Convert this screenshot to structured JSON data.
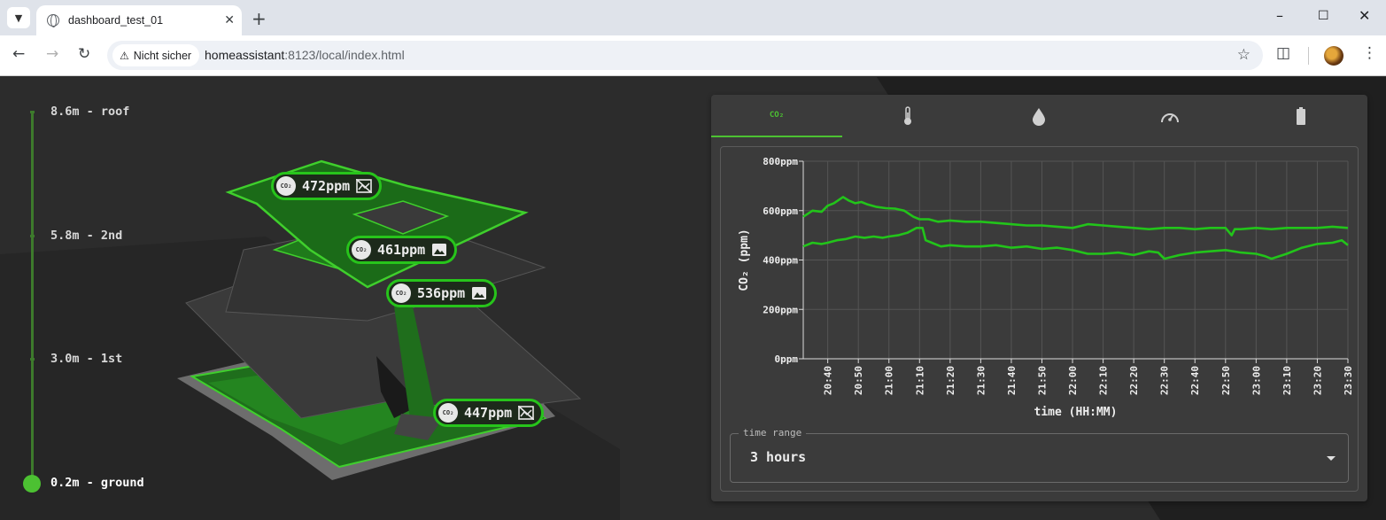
{
  "browser": {
    "tab_title": "dashboard_test_01",
    "security_label": "Nicht sicher",
    "url_host": "homeassistant",
    "url_rest": ":8123/local/index.html"
  },
  "levels": [
    {
      "label": "8.6m - roof"
    },
    {
      "label": "5.8m - 2nd"
    },
    {
      "label": "3.0m - 1st"
    },
    {
      "label": "0.2m - ground",
      "active": true
    }
  ],
  "sensors": [
    {
      "value": "472ppm",
      "icon": "image-off-icon"
    },
    {
      "value": "461ppm",
      "icon": "image-icon"
    },
    {
      "value": "536ppm",
      "icon": "image-icon"
    },
    {
      "value": "447ppm",
      "icon": "image-off-icon"
    }
  ],
  "co2_badge": "CO₂",
  "panel": {
    "tabs": [
      {
        "name": "co2",
        "label": "CO₂",
        "active": true
      },
      {
        "name": "temperature",
        "icon": "thermometer-icon"
      },
      {
        "name": "humidity",
        "icon": "water-drop-icon"
      },
      {
        "name": "pressure",
        "icon": "gauge-icon"
      },
      {
        "name": "battery",
        "icon": "battery-icon"
      }
    ],
    "time_range_label": "time range",
    "time_range_value": "3 hours"
  },
  "colors": {
    "accent": "#4cc132",
    "line": "#22c41a",
    "panel": "#3b3b3b"
  },
  "chart_data": {
    "type": "line",
    "xlabel": "time (HH:MM)",
    "ylabel": "CO₂ (ppm)",
    "ylim": [
      0,
      800
    ],
    "yticks": [
      "0ppm",
      "200ppm",
      "400ppm",
      "600ppm",
      "800ppm"
    ],
    "xticks": [
      "20:40",
      "20:50",
      "21:00",
      "21:10",
      "21:20",
      "21:30",
      "21:40",
      "21:50",
      "22:00",
      "22:10",
      "22:20",
      "22:30",
      "22:40",
      "22:50",
      "23:00",
      "23:10",
      "23:20",
      "23:30"
    ],
    "x_start": "20:32",
    "x_end": "23:30",
    "grid": true,
    "series": [
      {
        "x": [
          "20:32",
          "20:35",
          "20:38",
          "20:40",
          "20:42",
          "20:45",
          "20:47",
          "20:49",
          "20:51",
          "20:53",
          "20:56",
          "20:59",
          "21:02",
          "21:05",
          "21:08",
          "21:10",
          "21:13",
          "21:16",
          "21:20",
          "21:25",
          "21:30",
          "21:35",
          "21:40",
          "21:45",
          "21:50",
          "21:55",
          "22:00",
          "22:05",
          "22:10",
          "22:15",
          "22:20",
          "22:25",
          "22:30",
          "22:35",
          "22:40",
          "22:45",
          "22:50",
          "22:52",
          "22:53",
          "22:55",
          "23:00",
          "23:05",
          "23:10",
          "23:15",
          "23:20",
          "23:25",
          "23:30"
        ],
        "values": [
          575,
          600,
          595,
          620,
          630,
          655,
          640,
          630,
          635,
          625,
          615,
          610,
          608,
          600,
          575,
          565,
          565,
          555,
          560,
          555,
          555,
          550,
          545,
          540,
          540,
          535,
          530,
          545,
          540,
          535,
          530,
          525,
          530,
          530,
          525,
          530,
          530,
          500,
          525,
          525,
          530,
          525,
          530,
          530,
          530,
          535,
          530
        ]
      },
      {
        "x": [
          "20:32",
          "20:35",
          "20:38",
          "20:40",
          "20:43",
          "20:46",
          "20:49",
          "20:52",
          "20:55",
          "20:58",
          "21:00",
          "21:03",
          "21:06",
          "21:09",
          "21:11",
          "21:12",
          "21:14",
          "21:17",
          "21:20",
          "21:25",
          "21:30",
          "21:35",
          "21:40",
          "21:45",
          "21:50",
          "21:55",
          "22:00",
          "22:05",
          "22:10",
          "22:15",
          "22:20",
          "22:25",
          "22:28",
          "22:30",
          "22:35",
          "22:40",
          "22:45",
          "22:50",
          "22:55",
          "23:00",
          "23:03",
          "23:05",
          "23:10",
          "23:15",
          "23:20",
          "23:25",
          "23:28",
          "23:30"
        ],
        "values": [
          455,
          470,
          465,
          470,
          480,
          485,
          495,
          490,
          495,
          490,
          495,
          500,
          510,
          530,
          530,
          480,
          470,
          455,
          460,
          455,
          455,
          460,
          450,
          455,
          445,
          450,
          440,
          425,
          425,
          430,
          420,
          435,
          430,
          405,
          420,
          430,
          435,
          440,
          430,
          425,
          415,
          405,
          425,
          450,
          465,
          470,
          480,
          460
        ]
      }
    ]
  }
}
